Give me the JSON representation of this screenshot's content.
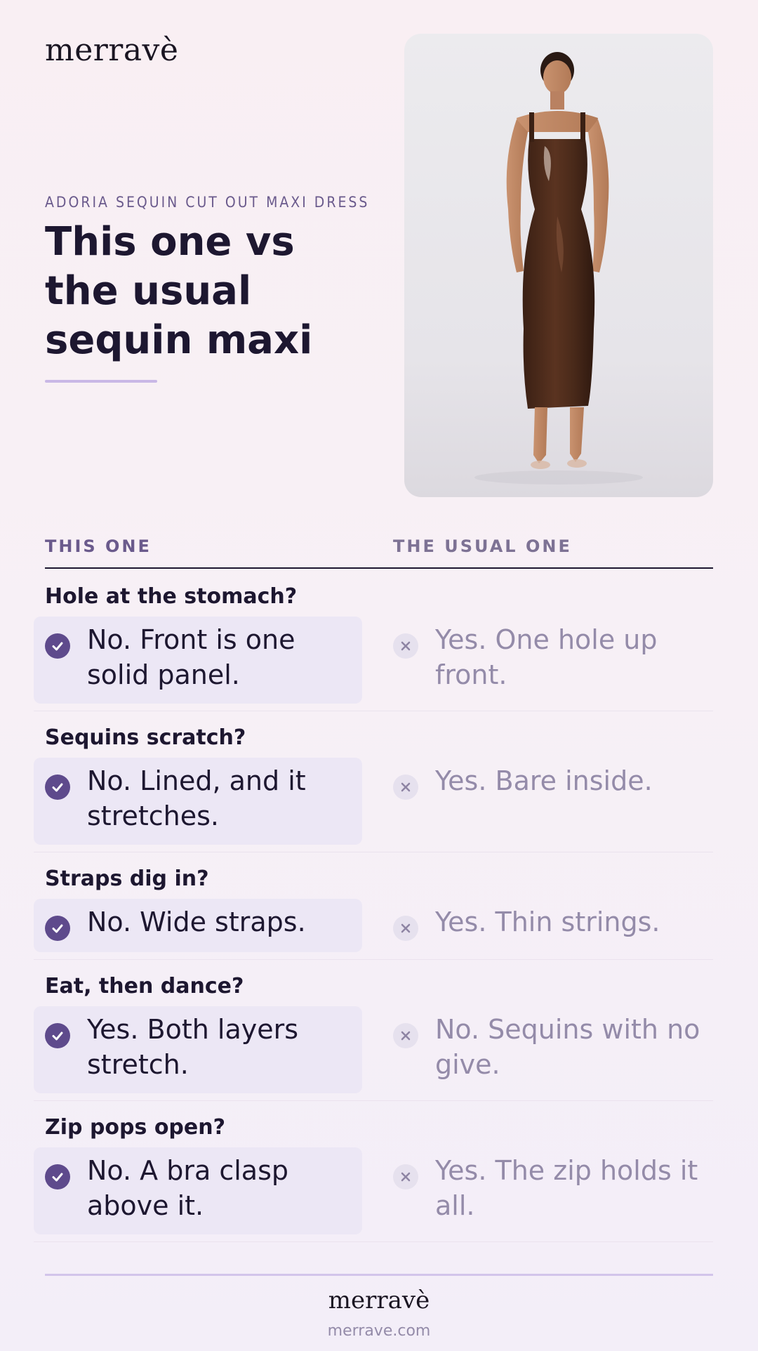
{
  "brand": {
    "logo": "merravè",
    "url": "merrave.com"
  },
  "hero": {
    "eyebrow": "ADORIA SEQUIN CUT OUT MAXI DRESS",
    "headline": "This one vs the usual sequin maxi"
  },
  "comparison": {
    "this_one_label": "THIS ONE",
    "usual_one_label": "THE USUAL ONE",
    "rows": [
      {
        "question": "Hole at the stomach?",
        "this_one": "No. Front is one solid panel.",
        "usual_one": "Yes. One hole up front."
      },
      {
        "question": "Sequins scratch?",
        "this_one": "No. Lined, and it stretches.",
        "usual_one": "Yes. Bare inside."
      },
      {
        "question": "Straps dig in?",
        "this_one": "No. Wide straps.",
        "usual_one": "Yes. Thin strings."
      },
      {
        "question": "Eat, then dance?",
        "this_one": "Yes. Both layers stretch.",
        "usual_one": "No. Sequins with no give."
      },
      {
        "question": "Zip pops open?",
        "this_one": "No. A bra clasp above it.",
        "usual_one": "Yes. The zip holds it all."
      }
    ]
  },
  "icons": {
    "positive": "check-circle-icon",
    "negative": "x-circle-icon"
  },
  "colors": {
    "accent": "#5e4a8c",
    "heading": "#1d1730",
    "muted": "#948ba9",
    "highlight_bg": "#ece7f5"
  }
}
